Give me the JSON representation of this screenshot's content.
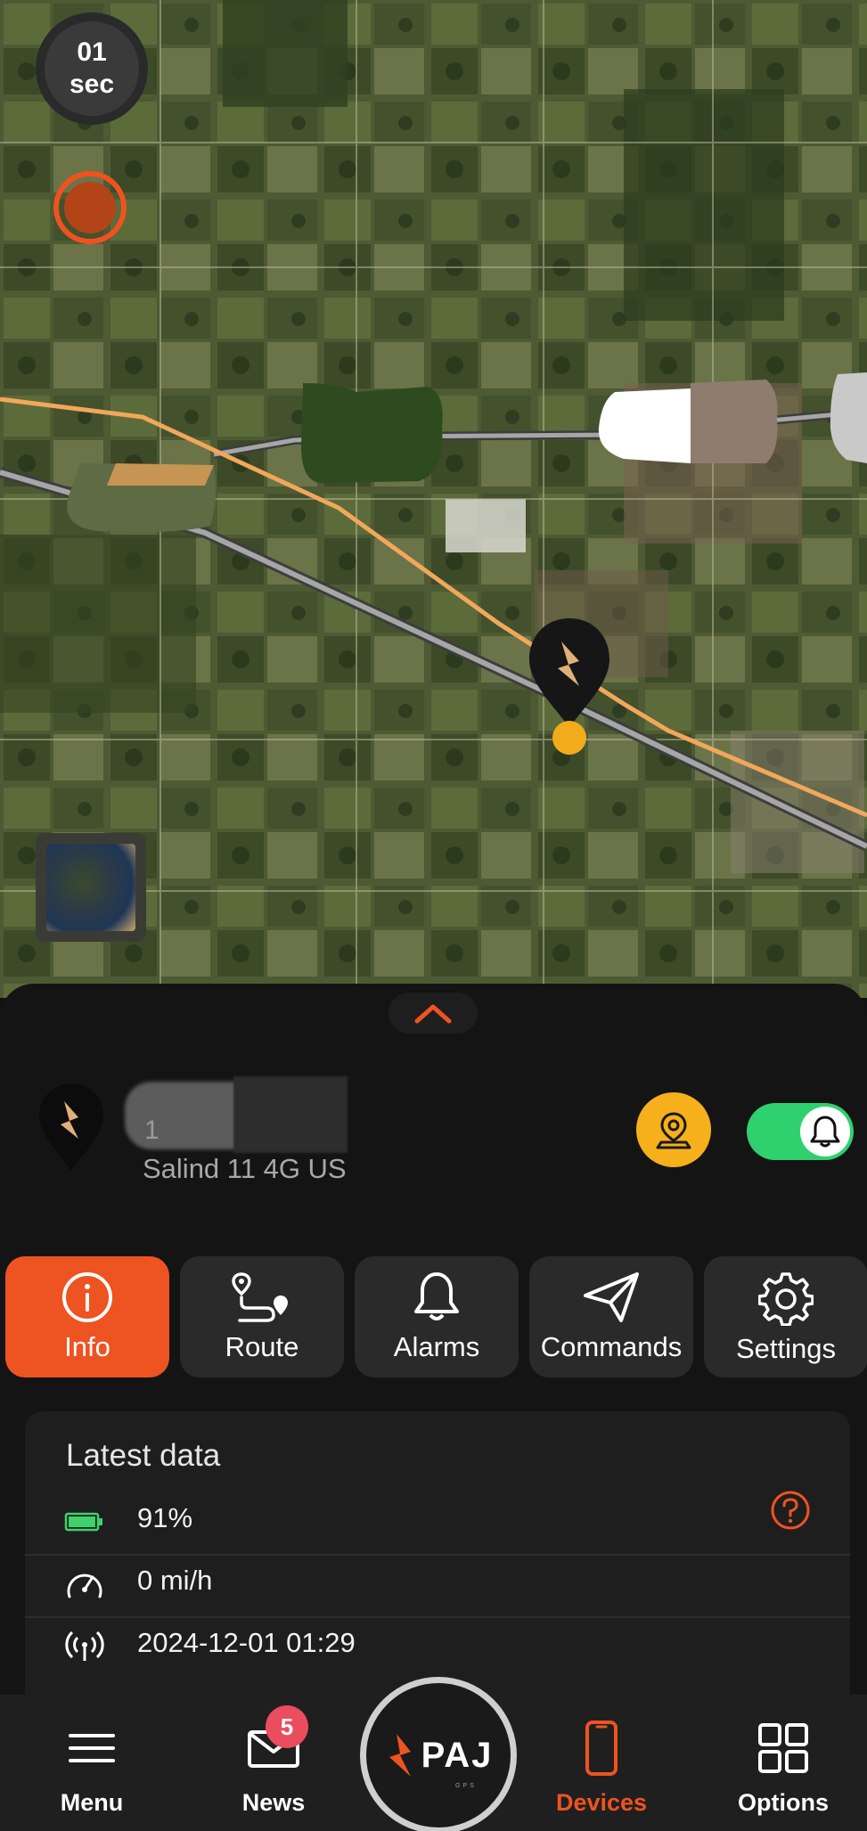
{
  "map": {
    "refresh_timer": {
      "value": "01",
      "unit": "sec"
    },
    "record_button_icon": "record-icon",
    "layer_button_icon": "map-layer-thumbnail",
    "device_marker_icon": "paj-pin-icon",
    "colors": {
      "route_orange": "#f2a75a",
      "road_gray": "#9c9c9c",
      "accent": "#ee5322",
      "pin_yellow": "#f2ab1b"
    }
  },
  "panel": {
    "expand_icon": "chevron-up-icon",
    "device": {
      "name": "1",
      "model": "Salind 11 4G US"
    },
    "locate_icon": "location-pin-icon",
    "alarm_toggle": {
      "on": true,
      "icon": "bell-icon"
    },
    "tabs": [
      {
        "label": "Info",
        "icon": "info-icon",
        "active": true
      },
      {
        "label": "Route",
        "icon": "route-icon",
        "active": false
      },
      {
        "label": "Alarms",
        "icon": "bell-icon",
        "active": false
      },
      {
        "label": "Commands",
        "icon": "send-icon",
        "active": false
      },
      {
        "label": "Settings",
        "icon": "gear-icon",
        "active": false
      }
    ],
    "latest_data": {
      "title": "Latest data",
      "battery": "91%",
      "speed": "0 mi/h",
      "last_signal": "2024-12-01 01:29"
    }
  },
  "bottom_nav": {
    "menu": "Menu",
    "news": "News",
    "news_badge": "5",
    "logo": "PAJ",
    "logo_sub": "GPS",
    "devices": "Devices",
    "options": "Options"
  }
}
